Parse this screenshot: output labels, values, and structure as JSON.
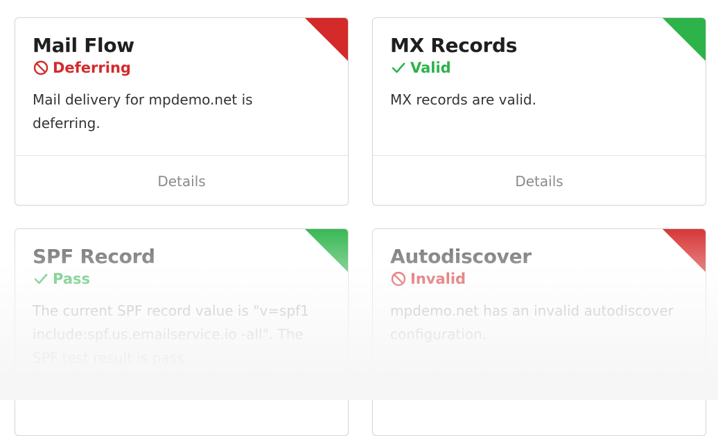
{
  "cards": [
    {
      "title": "Mail Flow",
      "status": "Deferring",
      "status_type": "error",
      "description": "Mail delivery for mpdemo.net is deferring.",
      "details_label": "Details",
      "corner_color": "#d42a2a"
    },
    {
      "title": "MX Records",
      "status": "Valid",
      "status_type": "success",
      "description": "MX records are valid.",
      "details_label": "Details",
      "corner_color": "#2db34a"
    },
    {
      "title": "SPF Record",
      "status": "Pass",
      "status_type": "success",
      "description": "The current SPF record value is \"v=spf1 include:spf.us.emailservice.io -all\". The SPF test result is pass.",
      "corner_color": "#2db34a"
    },
    {
      "title": "Autodiscover",
      "status": "Invalid",
      "status_type": "error",
      "description": "mpdemo.net has an invalid autodiscover configuration.",
      "corner_color": "#d42a2a"
    }
  ],
  "icons": {
    "error": "prohibited-icon",
    "success": "checkmark-icon"
  },
  "colors": {
    "error": "#d42a2a",
    "success": "#2db34a"
  }
}
